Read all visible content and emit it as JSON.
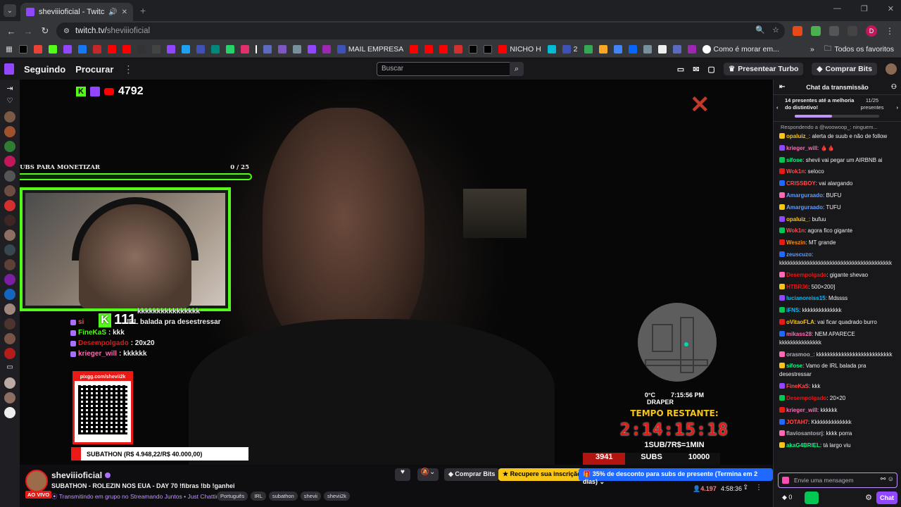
{
  "browser": {
    "tab_title": "sheviiioficial - Twitch",
    "url_main": "twitch.tv/",
    "url_path": "sheviiioficial",
    "profile_letter": "D",
    "bookmarks": [
      "MAIL EMPRESA",
      "NICHO H",
      "2",
      "Como é morar em...",
      "Todos os favoritos"
    ]
  },
  "twitch": {
    "nav_following": "Seguindo",
    "nav_browse": "Procurar",
    "search_placeholder": "Buscar",
    "turbo": "Presentear Turbo",
    "buy_bits": "Comprar Bits"
  },
  "overlay": {
    "platform_count": "4792",
    "subs_title": "SUBS PARA MONETIZAR",
    "subs_progress": "0 / 25",
    "subs_fraction": 0,
    "kick_count": "111",
    "chat": [
      {
        "user": "",
        "text": "kkkkkkkkkkkkkkkk"
      },
      {
        "user": "si",
        "text": "IRL balada pra desestressar"
      },
      {
        "user": "FineKaS",
        "text": ": kkk"
      },
      {
        "user": "Desempolgado",
        "text": ": 20x20"
      },
      {
        "user": "krieger_will",
        "text": ": kkkkkk"
      }
    ],
    "qr_url": "pixgg.com/shevii2k",
    "subathon": "SUBATHON (R$ 4.948,22/R$ 40.000,00)",
    "temperature": "0°C",
    "clock": "7:15:56 PM",
    "city": "DRAPER",
    "time_left_label": "TEMPO RESTANTE:",
    "timer": "2:14:15:18",
    "rate": "1SUB/7R$=1MIN",
    "subs_current": "3941",
    "subs_label": "SUBS",
    "subs_goal": "10000"
  },
  "stream": {
    "channel": "sheviiioficial",
    "live": "AO VIVO",
    "title": "SUBATHON - ROLEZIN NOS EUA - DAY 70 !fibras !bb !ganhei",
    "group": "Transmitindo em grupo no Streamando Juntos",
    "category": "Just Chatting",
    "tags": [
      "Português",
      "IRL",
      "subathon",
      "shevii",
      "shevii2k"
    ],
    "buy_bits": "Comprar Bits",
    "renew_sub": "Recupere sua inscrição",
    "promo": "35% de desconto para subs de presente (Termina em 2 dias)",
    "viewers": "4.197",
    "uptime": "4:58:36"
  },
  "chat": {
    "header": "Chat da transmissão",
    "gift_text": "14 presentes até a melhoria do distintivo!",
    "gift_count": "11/25 presentes",
    "gift_fraction": 0.44,
    "reply": "Respondendo a @woowoop_: ninguem...",
    "messages": [
      {
        "user": "opaluiz_",
        "color": "#f5c518",
        "text": ": alerta de suub e não de follow"
      },
      {
        "user": "krieger_will",
        "color": "#ff69b4",
        "text": ": 🩸🩸"
      },
      {
        "user": "sifose",
        "color": "#00ff7f",
        "text": ": shevii vai pegar um AIRBNB ai"
      },
      {
        "user": "Wok1n",
        "color": "#ff4b4b",
        "text": ": seloco"
      },
      {
        "user": "CRISSBOY",
        "color": "#ff4b4b",
        "text": ": vai alargando"
      },
      {
        "user": "Amarguraado",
        "color": "#5c9cff",
        "text": ": BUFU"
      },
      {
        "user": "Amarguraado",
        "color": "#5c9cff",
        "text": ": TUFU"
      },
      {
        "user": "opaluiz_",
        "color": "#f5c518",
        "text": ": bufuu"
      },
      {
        "user": "Wok1n",
        "color": "#ff4b4b",
        "text": ": agora fico gigante"
      },
      {
        "user": "Weszin",
        "color": "#ff8c00",
        "text": ": MT grande"
      },
      {
        "user": "zeuscuzo",
        "color": "#5c9cff",
        "text": ": kkkkkkkkkkkkkkkkkkkkkkkkkkkkkkkkkkkkkkkk"
      },
      {
        "user": "Desempolgado",
        "color": "#e91916",
        "text": ": gigante shevao"
      },
      {
        "user": "HTBR36",
        "color": "#e91916",
        "text": ": 500×200]"
      },
      {
        "user": "lucianoreiss15",
        "color": "#00bfff",
        "text": ": Mdssss"
      },
      {
        "user": "iFNS",
        "color": "#00bfff",
        "text": ": kkkkkkkkkkkkkk"
      },
      {
        "user": "oVitaoFLA",
        "color": "#f5c518",
        "text": ": vai ficar quadrado burro"
      },
      {
        "user": "mikass28",
        "color": "#ff69b4",
        "text": ": NEM APARECE kkkkkkkkkkkkkkk"
      },
      {
        "user": "orasmoo_",
        "color": "#adadb8",
        "text": ": kkkkkkkkkkkkkkkkkkkkkkkkkkk"
      },
      {
        "user": "sifose",
        "color": "#00ff7f",
        "text": ": Vamo de IRL balada pra desestressar"
      },
      {
        "user": "FineKaS",
        "color": "#ff4b4b",
        "text": ": kkk"
      },
      {
        "user": "Desempolgado",
        "color": "#e91916",
        "text": ": 20×20"
      },
      {
        "user": "krieger_will",
        "color": "#ff69b4",
        "text": ": kkkkkk"
      },
      {
        "user": "JOTAH7",
        "color": "#ff4b4b",
        "text": ": Kkkkkkkkkkkkkk"
      },
      {
        "user": "flaviosantosrj",
        "color": "#adadb8",
        "text": ": kkkk porra"
      },
      {
        "user": "akaG4BRIEL",
        "color": "#00ff7f",
        "text": ": tá largo viu"
      }
    ],
    "input_placeholder": "Envie uma mensagem",
    "bits": "0",
    "send": "Chat"
  }
}
